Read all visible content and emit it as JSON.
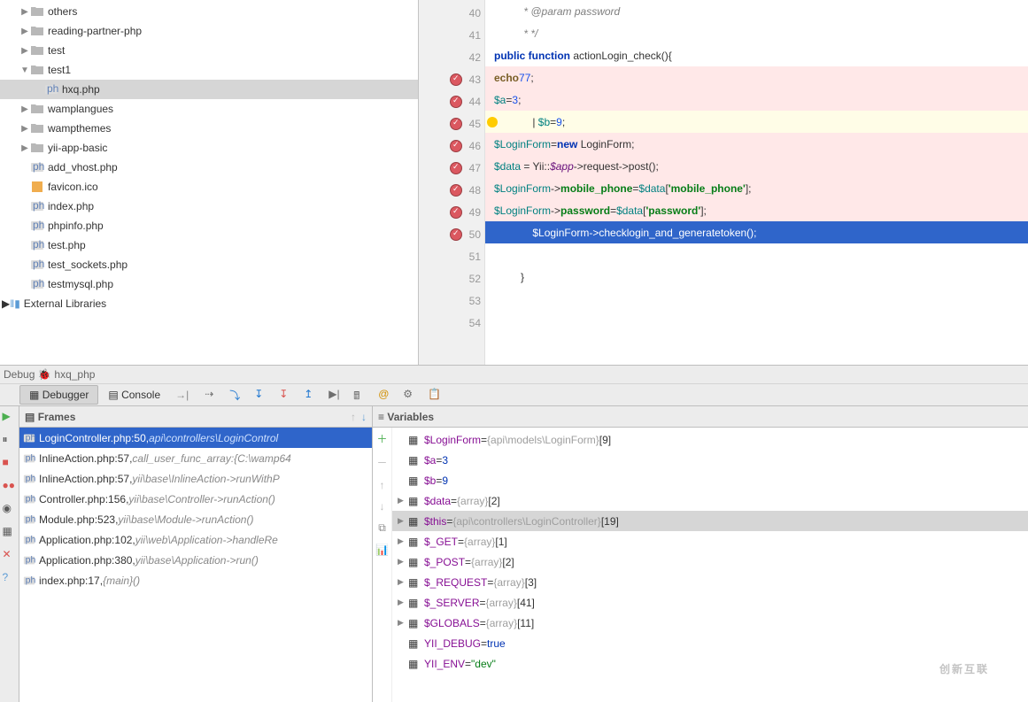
{
  "tree": {
    "items": [
      {
        "indent": 1,
        "arrow": "▶",
        "kind": "folder",
        "label": "others"
      },
      {
        "indent": 1,
        "arrow": "▶",
        "kind": "folder",
        "label": "reading-partner-php"
      },
      {
        "indent": 1,
        "arrow": "▶",
        "kind": "folder",
        "label": "test"
      },
      {
        "indent": 1,
        "arrow": "▼",
        "kind": "folder",
        "label": "test1"
      },
      {
        "indent": 2,
        "arrow": "",
        "kind": "php",
        "label": "hxq.php",
        "selected": true
      },
      {
        "indent": 1,
        "arrow": "▶",
        "kind": "folder",
        "label": "wamplangues"
      },
      {
        "indent": 1,
        "arrow": "▶",
        "kind": "folder",
        "label": "wampthemes"
      },
      {
        "indent": 1,
        "arrow": "▶",
        "kind": "folder",
        "label": "yii-app-basic"
      },
      {
        "indent": 1,
        "arrow": "",
        "kind": "php",
        "label": "add_vhost.php"
      },
      {
        "indent": 1,
        "arrow": "",
        "kind": "ico",
        "label": "favicon.ico"
      },
      {
        "indent": 1,
        "arrow": "",
        "kind": "php",
        "label": "index.php"
      },
      {
        "indent": 1,
        "arrow": "",
        "kind": "php",
        "label": "phpinfo.php"
      },
      {
        "indent": 1,
        "arrow": "",
        "kind": "php",
        "label": "test.php"
      },
      {
        "indent": 1,
        "arrow": "",
        "kind": "php",
        "label": "test_sockets.php"
      },
      {
        "indent": 1,
        "arrow": "",
        "kind": "php",
        "label": "testmysql.php"
      }
    ],
    "external_libs": "External Libraries"
  },
  "code": {
    "lines": [
      {
        "n": 40,
        "cls": "",
        "html": "          * @param password",
        "grey": true
      },
      {
        "n": 41,
        "cls": "",
        "html": "          * */",
        "grey": true
      },
      {
        "n": 42,
        "cls": "",
        "html": "         <span class='k-blue'>public function</span> actionLogin_check(){"
      },
      {
        "n": 43,
        "cls": "pink",
        "bp": true,
        "html": "            <span class='k-brown'>echo</span> <span class='k-num'>77</span>;"
      },
      {
        "n": 44,
        "cls": "pink",
        "bp": true,
        "html": "             <span class='k-teal'>$a</span>=<span class='k-num'>3</span>;"
      },
      {
        "n": 45,
        "cls": "pink caret",
        "bp": true,
        "bulb": true,
        "html": "             | <span class='k-teal'>$b</span>=<span class='k-num'>9</span>;"
      },
      {
        "n": 46,
        "cls": "pink",
        "bp": true,
        "html": "             <span class='k-teal'>$LoginForm</span>=<span class='k-blue'>new</span> LoginForm;"
      },
      {
        "n": 47,
        "cls": "pink",
        "bp": true,
        "html": "             <span class='k-teal'>$data</span> = Yii::<span class='k-purple'>$app</span>-&gt;request-&gt;post();"
      },
      {
        "n": 48,
        "cls": "pink",
        "bp": true,
        "html": "             <span class='k-teal'>$LoginForm</span>-&gt;<span class='k-green'>mobile_phone</span>=<span class='k-teal'>$data</span>[<span class='k-green'>'mobile_phone'</span>];"
      },
      {
        "n": 49,
        "cls": "pink",
        "bp": true,
        "html": "             <span class='k-teal'>$LoginForm</span>-&gt;<span class='k-green'>password</span>=<span class='k-teal'>$data</span>[<span class='k-green'>'password'</span>];"
      },
      {
        "n": 50,
        "cls": "curr",
        "bp": true,
        "html": "             $LoginForm-&gt;checklogin_and_generatetoken();"
      },
      {
        "n": 51,
        "cls": "",
        "html": ""
      },
      {
        "n": 52,
        "cls": "",
        "html": "         }"
      },
      {
        "n": 53,
        "cls": "",
        "html": ""
      },
      {
        "n": 54,
        "cls": "",
        "html": ""
      }
    ]
  },
  "debug": {
    "title": "Debug",
    "config": "hxq_php",
    "tabs": {
      "debugger": "Debugger",
      "console": "Console"
    },
    "frames_label": "Frames",
    "vars_label": "Variables",
    "frames": [
      {
        "sel": true,
        "main": "LoginController.php:50,",
        "ital": " api\\controllers\\LoginControl"
      },
      {
        "main": "InlineAction.php:57,",
        "ital": " call_user_func_array:{C:\\wamp64"
      },
      {
        "main": "InlineAction.php:57,",
        "ital": " yii\\base\\InlineAction->runWithP"
      },
      {
        "main": "Controller.php:156,",
        "ital": " yii\\base\\Controller->runAction()"
      },
      {
        "main": "Module.php:523,",
        "ital": " yii\\base\\Module->runAction()"
      },
      {
        "main": "Application.php:102,",
        "ital": " yii\\web\\Application->handleRe"
      },
      {
        "main": "Application.php:380,",
        "ital": " yii\\base\\Application->run()"
      },
      {
        "main": "index.php:17,",
        "ital": " {main}()"
      }
    ],
    "vars": [
      {
        "tri": "",
        "name": "$LoginForm",
        "sep": " = ",
        "meta": "{api\\models\\LoginForm} ",
        "extra": "[9]"
      },
      {
        "tri": "",
        "name": "$a",
        "sep": " = ",
        "val": "3"
      },
      {
        "tri": "",
        "name": "$b",
        "sep": " = ",
        "val": "9"
      },
      {
        "tri": "▶",
        "name": "$data",
        "sep": " = ",
        "meta": "{array} ",
        "extra": "[2]"
      },
      {
        "tri": "▶",
        "sel": true,
        "name": "$this",
        "sep": " = ",
        "meta": "{api\\controllers\\LoginController} ",
        "extra": "[19]"
      },
      {
        "tri": "▶",
        "name": "$_GET",
        "sep": " = ",
        "meta": "{array} ",
        "extra": "[1]"
      },
      {
        "tri": "▶",
        "name": "$_POST",
        "sep": " = ",
        "meta": "{array} ",
        "extra": "[2]"
      },
      {
        "tri": "▶",
        "name": "$_REQUEST",
        "sep": " = ",
        "meta": "{array} ",
        "extra": "[3]"
      },
      {
        "tri": "▶",
        "name": "$_SERVER",
        "sep": " = ",
        "meta": "{array} ",
        "extra": "[41]"
      },
      {
        "tri": "▶",
        "name": "$GLOBALS",
        "sep": " = ",
        "meta": "{array} ",
        "extra": "[11]"
      },
      {
        "tri": "",
        "name": "YII_DEBUG",
        "sep": " = ",
        "val": "true"
      },
      {
        "tri": "",
        "name": "YII_ENV",
        "sep": " = ",
        "str": "\"dev\""
      }
    ]
  },
  "logo": "创新互联"
}
